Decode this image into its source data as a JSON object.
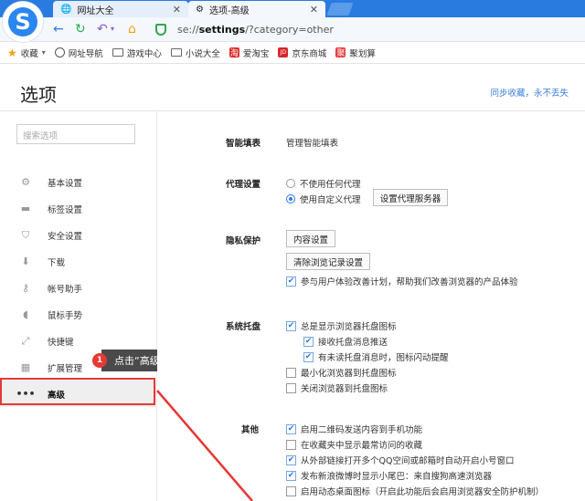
{
  "browser": {
    "logo_letter": "S",
    "tabs": [
      {
        "label": "网址大全",
        "icon": "globe-icon"
      },
      {
        "label": "选项-高级",
        "icon": "gear-icon"
      }
    ],
    "address": {
      "prefix": "se://",
      "bold": "settings",
      "suffix": "/?category=other"
    },
    "bookmarks": [
      {
        "label": "收藏",
        "icon": "star-icon"
      },
      {
        "label": "网址导航",
        "icon": "globe-icon"
      },
      {
        "label": "游戏中心",
        "icon": "folder-icon"
      },
      {
        "label": "小说大全",
        "icon": "folder-icon"
      },
      {
        "label": "爱淘宝",
        "icon": "taobao-icon",
        "glyph": "淘",
        "color": "#e02a2a"
      },
      {
        "label": "京东商城",
        "icon": "jd-icon",
        "glyph": "JD",
        "color": "#d8262c"
      },
      {
        "label": "聚划算",
        "icon": "juhuasuan-icon",
        "glyph": "聚",
        "color": "#e53a3a"
      }
    ]
  },
  "page": {
    "title": "选项",
    "sync_link": "同步收藏，永不丢失"
  },
  "sidebar": {
    "search_placeholder": "搜索选项",
    "items": [
      {
        "label": "基本设置",
        "icon": "gear-icon",
        "glyph": "⚙"
      },
      {
        "label": "标签设置",
        "icon": "tab-icon",
        "glyph": "▬"
      },
      {
        "label": "安全设置",
        "icon": "shield-icon",
        "glyph": "⛉"
      },
      {
        "label": "下载",
        "icon": "download-icon",
        "glyph": "⬇"
      },
      {
        "label": "帐号助手",
        "icon": "key-icon",
        "glyph": "⚷"
      },
      {
        "label": "鼠标手势",
        "icon": "mouse-icon",
        "glyph": "◖"
      },
      {
        "label": "快捷键",
        "icon": "shortcut-icon",
        "glyph": "⤢"
      },
      {
        "label": "扩展管理",
        "icon": "extensions-icon",
        "glyph": "▦"
      },
      {
        "label": "高级",
        "icon": "more-icon",
        "glyph": "•••"
      }
    ],
    "active_index": 8
  },
  "annotation": {
    "number": "1",
    "text": "点击“高级”"
  },
  "sections": {
    "smart_fill": {
      "label": "智能填表",
      "link": "管理智能填表"
    },
    "proxy": {
      "label": "代理设置",
      "option_none": "不使用任何代理",
      "option_custom": "使用自定义代理",
      "button": "设置代理服务器",
      "selected": "custom"
    },
    "privacy": {
      "label": "隐私保护",
      "content_button": "内容设置",
      "clear_button": "清除浏览记录设置",
      "ux_checkbox": "参与用户体验改善计划，帮助我们改善浏览器的产品体验"
    },
    "tray": {
      "label": "系统托盘",
      "show_icon": "总是显示浏览器托盘图标",
      "receive_push": "接收托盘消息推送",
      "blink_icon": "有未读托盘消息时，图标闪动提醒",
      "minimize": "最小化浏览器到托盘图标",
      "close": "关闭浏览器到托盘图标"
    },
    "other": {
      "label": "其他",
      "items": [
        {
          "label": "启用二维码发送内容到手机功能",
          "checked": true
        },
        {
          "label": "在收藏夹中显示最常访问的收藏",
          "checked": false
        },
        {
          "label": "从外部链接打开多个QQ空间或邮箱时自动开启小号窗口",
          "checked": true
        },
        {
          "label": "发布新浪微博时显示小尾巴：来自搜狗高速浏览器",
          "checked": true
        },
        {
          "label": "启用动态桌面图标（开启此功能后会启用浏览器安全防护机制）",
          "checked": false
        }
      ]
    }
  },
  "colors": {
    "accent": "#2a7be0",
    "highlight": "#e53935",
    "link": "#3b7dd8"
  }
}
